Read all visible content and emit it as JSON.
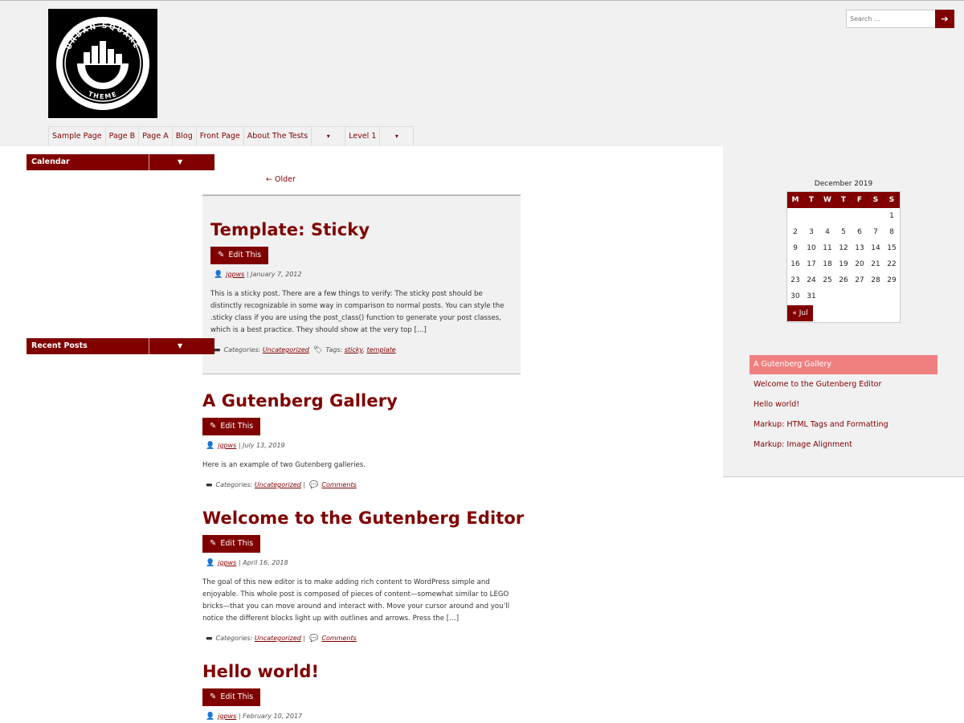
{
  "header": {
    "logo_alt": "URBAN SQUARE THEME",
    "logo_text_top": "URBAN SQUARE",
    "logo_text_bottom": "THEME",
    "search_placeholder": "Search ...",
    "search_button_icon": "arrow-right-icon"
  },
  "menu": {
    "items": [
      {
        "label": "Sample Page"
      },
      {
        "label": "Page B"
      },
      {
        "label": "Page A"
      },
      {
        "label": "Blog"
      },
      {
        "label": "Front Page"
      },
      {
        "label": "About The Tests"
      },
      {
        "label": "▾",
        "dropdown": true
      },
      {
        "label": "Level 1"
      },
      {
        "label": "▾",
        "dropdown": true
      }
    ]
  },
  "nav": {
    "older": "← Older"
  },
  "posts": [
    {
      "title": "Template: Sticky",
      "edit": "Edit This",
      "author": "jgpws",
      "date": "January 7, 2012",
      "excerpt": "This is a sticky post. There are a few things to verify: The sticky post should be distinctly recognizable in some way in comparison to normal posts. You can style the .sticky class if you are using the post_class() function to generate your post classes, which is a best practice. They should show at the very top […]",
      "categories_label": "Categories:",
      "category": "Uncategorized",
      "tags_label": "Tags:",
      "tag1": "sticky",
      "tag2": "template"
    },
    {
      "title": "A Gutenberg Gallery",
      "edit": "Edit This",
      "author": "jgpws",
      "date": "July 13, 2019",
      "excerpt": "Here is an example of two Gutenberg galleries.",
      "categories_label": "Categories:",
      "category": "Uncategorized",
      "comments": "Comments"
    },
    {
      "title": "Welcome to the Gutenberg Editor",
      "edit": "Edit This",
      "author": "jgpws",
      "date": "April 16, 2018",
      "excerpt": "The goal of this new editor is to make adding rich content to WordPress simple and enjoyable. This whole post is composed of pieces of content—somewhat similar to LEGO bricks—that you can move around and interact with. Move your cursor around and you’ll notice the different blocks light up with outlines and arrows. Press the […]",
      "categories_label": "Categories:",
      "category": "Uncategorized",
      "comments": "Comments"
    },
    {
      "title": "Hello world!",
      "edit": "Edit This",
      "author": "jgpws",
      "date": "February 10, 2017"
    }
  ],
  "sidebar": {
    "calendar": {
      "title": "Calendar",
      "caption": "December 2019",
      "days": [
        "M",
        "T",
        "W",
        "T",
        "F",
        "S",
        "S"
      ],
      "weeks": [
        [
          "",
          "",
          "",
          "",
          "",
          "",
          "1"
        ],
        [
          "2",
          "3",
          "4",
          "5",
          "6",
          "7",
          "8"
        ],
        [
          "9",
          "10",
          "11",
          "12",
          "13",
          "14",
          "15"
        ],
        [
          "16",
          "17",
          "18",
          "19",
          "20",
          "21",
          "22"
        ],
        [
          "23",
          "24",
          "25",
          "26",
          "27",
          "28",
          "29"
        ],
        [
          "30",
          "31",
          "",
          "",
          "",
          "",
          ""
        ]
      ],
      "prev": "« Jul"
    },
    "recent": {
      "title": "Recent Posts",
      "items": [
        "A Gutenberg Gallery",
        "Welcome to the Gutenberg Editor",
        "Hello world!",
        "Markup: HTML Tags and Formatting",
        "Markup: Image Alignment"
      ]
    }
  },
  "colors": {
    "accent": "#800000",
    "highlight": "#f08080",
    "background": "#f1f1f1"
  }
}
